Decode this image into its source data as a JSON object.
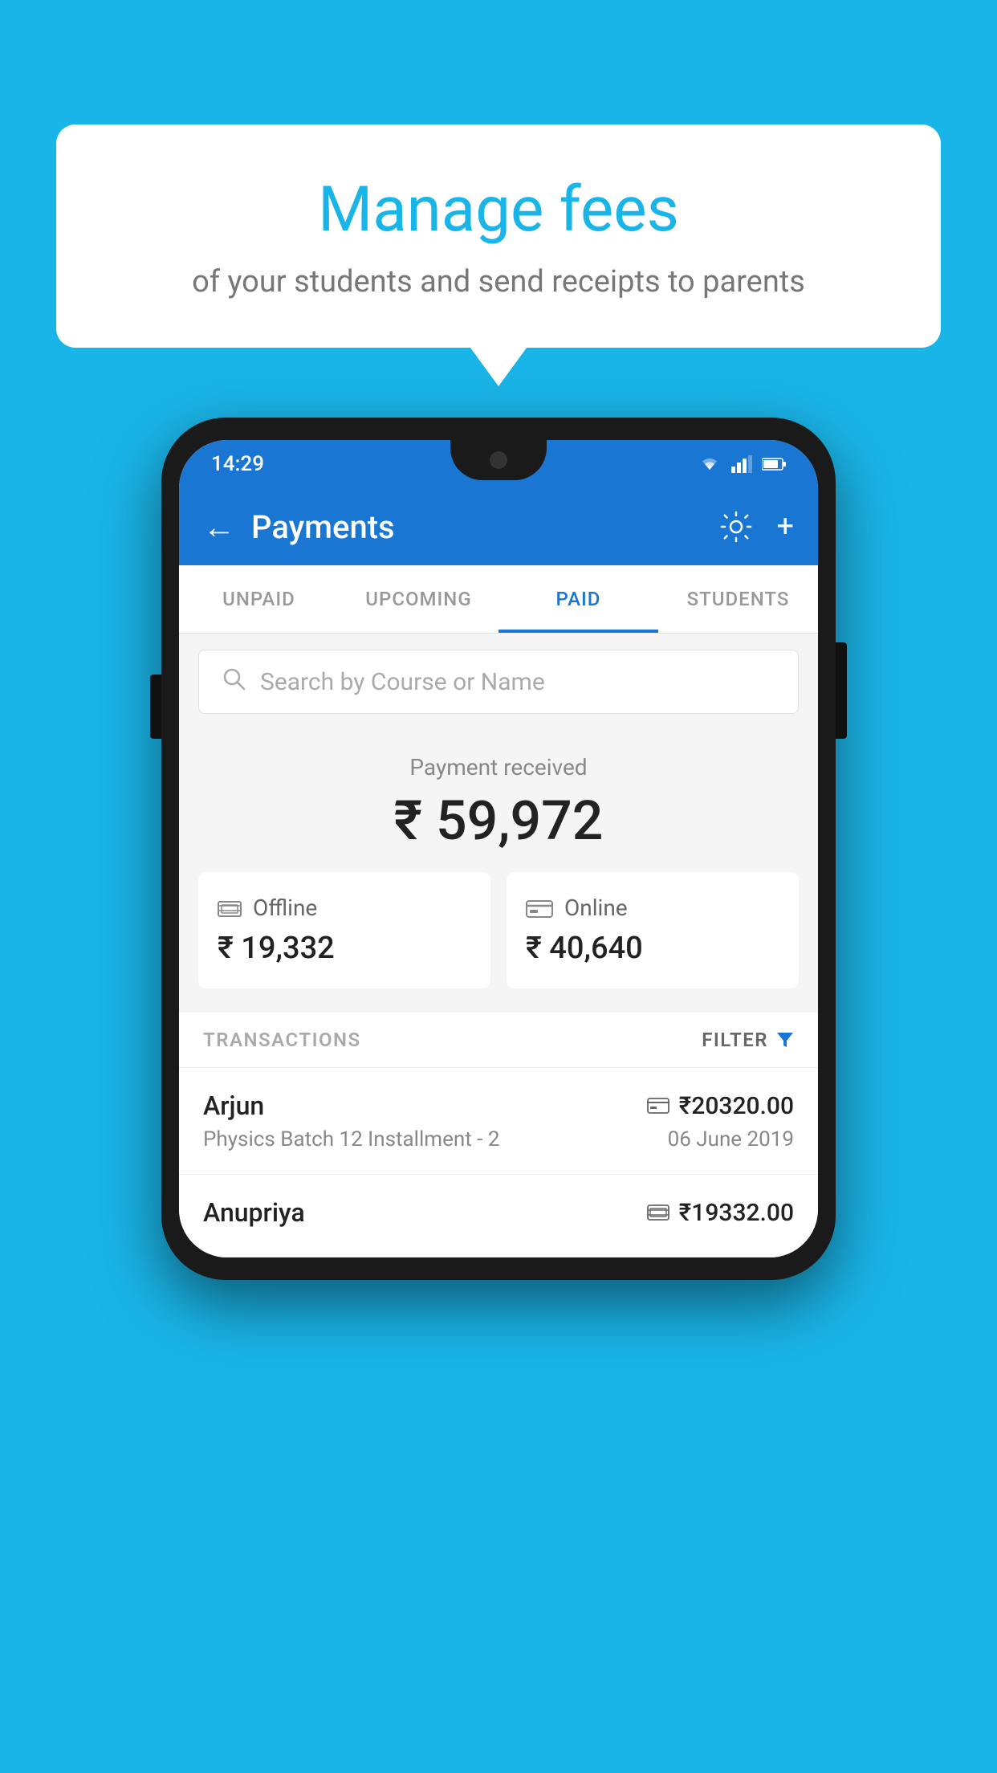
{
  "background": {
    "color": "#1ab5e8"
  },
  "speech_bubble": {
    "title": "Manage fees",
    "subtitle": "of your students and send receipts to parents"
  },
  "status_bar": {
    "time": "14:29",
    "wifi_icon": "wifi-icon",
    "signal_icon": "signal-icon",
    "battery_icon": "battery-icon"
  },
  "app_bar": {
    "back_icon": "←",
    "title": "Payments",
    "settings_icon": "⚙",
    "add_icon": "+"
  },
  "tabs": [
    {
      "label": "UNPAID",
      "active": false
    },
    {
      "label": "UPCOMING",
      "active": false
    },
    {
      "label": "PAID",
      "active": true
    },
    {
      "label": "STUDENTS",
      "active": false
    }
  ],
  "search": {
    "placeholder": "Search by Course or Name"
  },
  "payment_received": {
    "label": "Payment received",
    "amount": "₹ 59,972"
  },
  "payment_cards": [
    {
      "type": "Offline",
      "icon": "offline",
      "amount": "₹ 19,332"
    },
    {
      "type": "Online",
      "icon": "online",
      "amount": "₹ 40,640"
    }
  ],
  "transactions": {
    "header_label": "TRANSACTIONS",
    "filter_label": "FILTER"
  },
  "transaction_rows": [
    {
      "name": "Arjun",
      "description": "Physics Batch 12 Installment - 2",
      "amount": "₹20320.00",
      "date": "06 June 2019",
      "payment_type": "online"
    },
    {
      "name": "Anupriya",
      "description": "",
      "amount": "₹19332.00",
      "date": "",
      "payment_type": "offline"
    }
  ]
}
